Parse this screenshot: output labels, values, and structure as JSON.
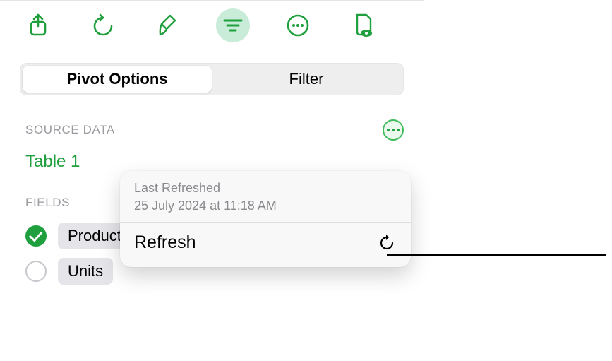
{
  "toolbar": {
    "share": "share-icon",
    "undo": "undo-icon",
    "format_painter": "paintbrush-icon",
    "pivot": "pivot-icon",
    "more": "more-icon",
    "review": "review-icon"
  },
  "tabs": {
    "pivot_options": "Pivot Options",
    "filter": "Filter",
    "selected": "pivot_options"
  },
  "source": {
    "section_label": "SOURCE DATA",
    "table_name": "Table 1"
  },
  "fields": {
    "section_label": "FIELDS",
    "items": [
      {
        "label": "Product",
        "checked": true
      },
      {
        "label": "Units",
        "checked": false
      }
    ]
  },
  "popover": {
    "meta_title": "Last Refreshed",
    "meta_detail": "25 July 2024  at 11:18 AM",
    "action_label": "Refresh"
  }
}
